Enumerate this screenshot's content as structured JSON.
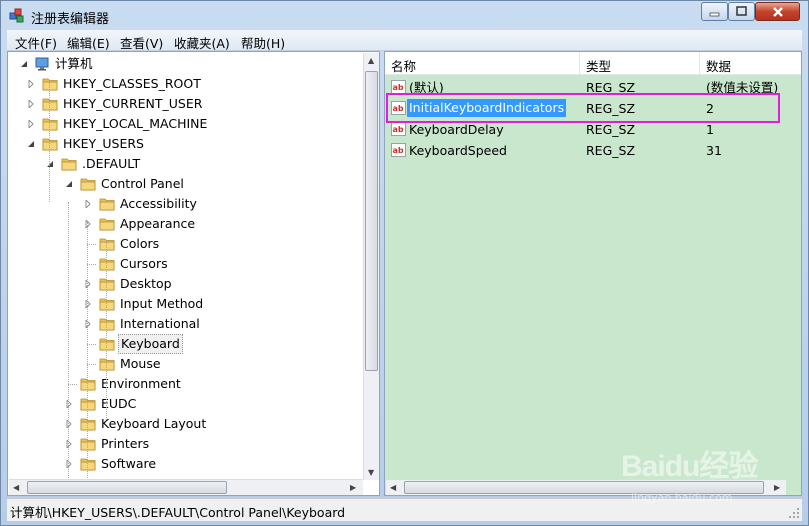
{
  "window": {
    "title": "注册表编辑器"
  },
  "menu": [
    "文件(F)",
    "编辑(E)",
    "查看(V)",
    "收藏夹(A)",
    "帮助(H)"
  ],
  "tree": {
    "root": "计算机",
    "items": [
      {
        "label": "HKEY_CLASSES_ROOT",
        "level": 1,
        "expander": "collapsed"
      },
      {
        "label": "HKEY_CURRENT_USER",
        "level": 1,
        "expander": "collapsed"
      },
      {
        "label": "HKEY_LOCAL_MACHINE",
        "level": 1,
        "expander": "collapsed"
      },
      {
        "label": "HKEY_USERS",
        "level": 1,
        "expander": "expanded"
      },
      {
        "label": ".DEFAULT",
        "level": 2,
        "expander": "expanded"
      },
      {
        "label": "Control Panel",
        "level": 3,
        "expander": "expanded"
      },
      {
        "label": "Accessibility",
        "level": 4,
        "expander": "collapsed"
      },
      {
        "label": "Appearance",
        "level": 4,
        "expander": "collapsed"
      },
      {
        "label": "Colors",
        "level": 4,
        "expander": "none"
      },
      {
        "label": "Cursors",
        "level": 4,
        "expander": "none"
      },
      {
        "label": "Desktop",
        "level": 4,
        "expander": "collapsed"
      },
      {
        "label": "Input Method",
        "level": 4,
        "expander": "collapsed"
      },
      {
        "label": "International",
        "level": 4,
        "expander": "collapsed"
      },
      {
        "label": "Keyboard",
        "level": 4,
        "expander": "none",
        "selected": true
      },
      {
        "label": "Mouse",
        "level": 4,
        "expander": "none"
      },
      {
        "label": "Environment",
        "level": 3,
        "expander": "none"
      },
      {
        "label": "EUDC",
        "level": 3,
        "expander": "collapsed"
      },
      {
        "label": "Keyboard Layout",
        "level": 3,
        "expander": "collapsed"
      },
      {
        "label": "Printers",
        "level": 3,
        "expander": "collapsed"
      },
      {
        "label": "Software",
        "level": 3,
        "expander": "collapsed"
      }
    ]
  },
  "list": {
    "columns": [
      "名称",
      "类型",
      "数据"
    ],
    "rows": [
      {
        "name": "(默认)",
        "type": "REG_SZ",
        "data": "(数值未设置)"
      },
      {
        "name": "InitialKeyboardIndicators",
        "type": "REG_SZ",
        "data": "2",
        "selected": true
      },
      {
        "name": "KeyboardDelay",
        "type": "REG_SZ",
        "data": "1"
      },
      {
        "name": "KeyboardSpeed",
        "type": "REG_SZ",
        "data": "31"
      }
    ]
  },
  "status": {
    "path": "计算机\\HKEY_USERS\\.DEFAULT\\Control Panel\\Keyboard"
  },
  "watermark": {
    "main": "Baidu经验",
    "sub": "jingyan.baidu.com"
  },
  "colors": {
    "list_background": "#c9e7cc",
    "selection": "#3399ff",
    "highlight_box": "#e020d8",
    "folder": "#e9c25a"
  },
  "icons": {
    "app": "registry-editor-icon",
    "computer": "computer-icon",
    "folder": "folder-icon",
    "value": "string-value-icon"
  }
}
